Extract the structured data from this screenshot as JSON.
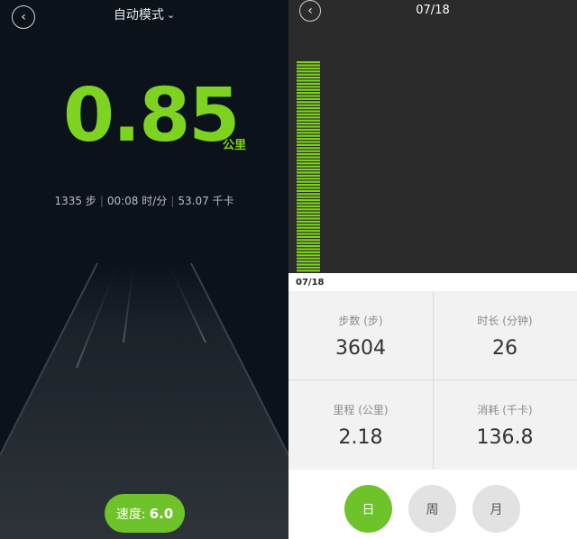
{
  "left": {
    "mode_label": "自动模式",
    "distance": "0.85",
    "distance_unit": "公里",
    "steps": "1335 步",
    "pace": "00:08 时/分",
    "calories": "53.07 千卡",
    "stat_separator": "|",
    "speed_label": "速度:",
    "speed_value": "6.0"
  },
  "right": {
    "date_title": "07/18",
    "date_label": "07/18",
    "stats": [
      {
        "label": "步数 (步)",
        "value": "3604"
      },
      {
        "label": "时长 (分钟)",
        "value": "26"
      },
      {
        "label": "里程 (公里)",
        "value": "2.18"
      },
      {
        "label": "消耗 (千卡)",
        "value": "136.8"
      }
    ],
    "periods": [
      {
        "label": "日",
        "active": true
      },
      {
        "label": "周",
        "active": false
      },
      {
        "label": "月",
        "active": false
      }
    ]
  },
  "colors": {
    "accent": "#7ed321",
    "left_bg": "#0c121a",
    "chart_bg": "#2b2b2b"
  },
  "icons": {
    "back": "chevron-left-icon",
    "mode_dropdown": "chevron-down-icon"
  },
  "chart_data": {
    "type": "bar",
    "categories": [
      "07/18"
    ],
    "values": [
      3604
    ],
    "title": "",
    "xlabel": "",
    "ylabel": ""
  }
}
